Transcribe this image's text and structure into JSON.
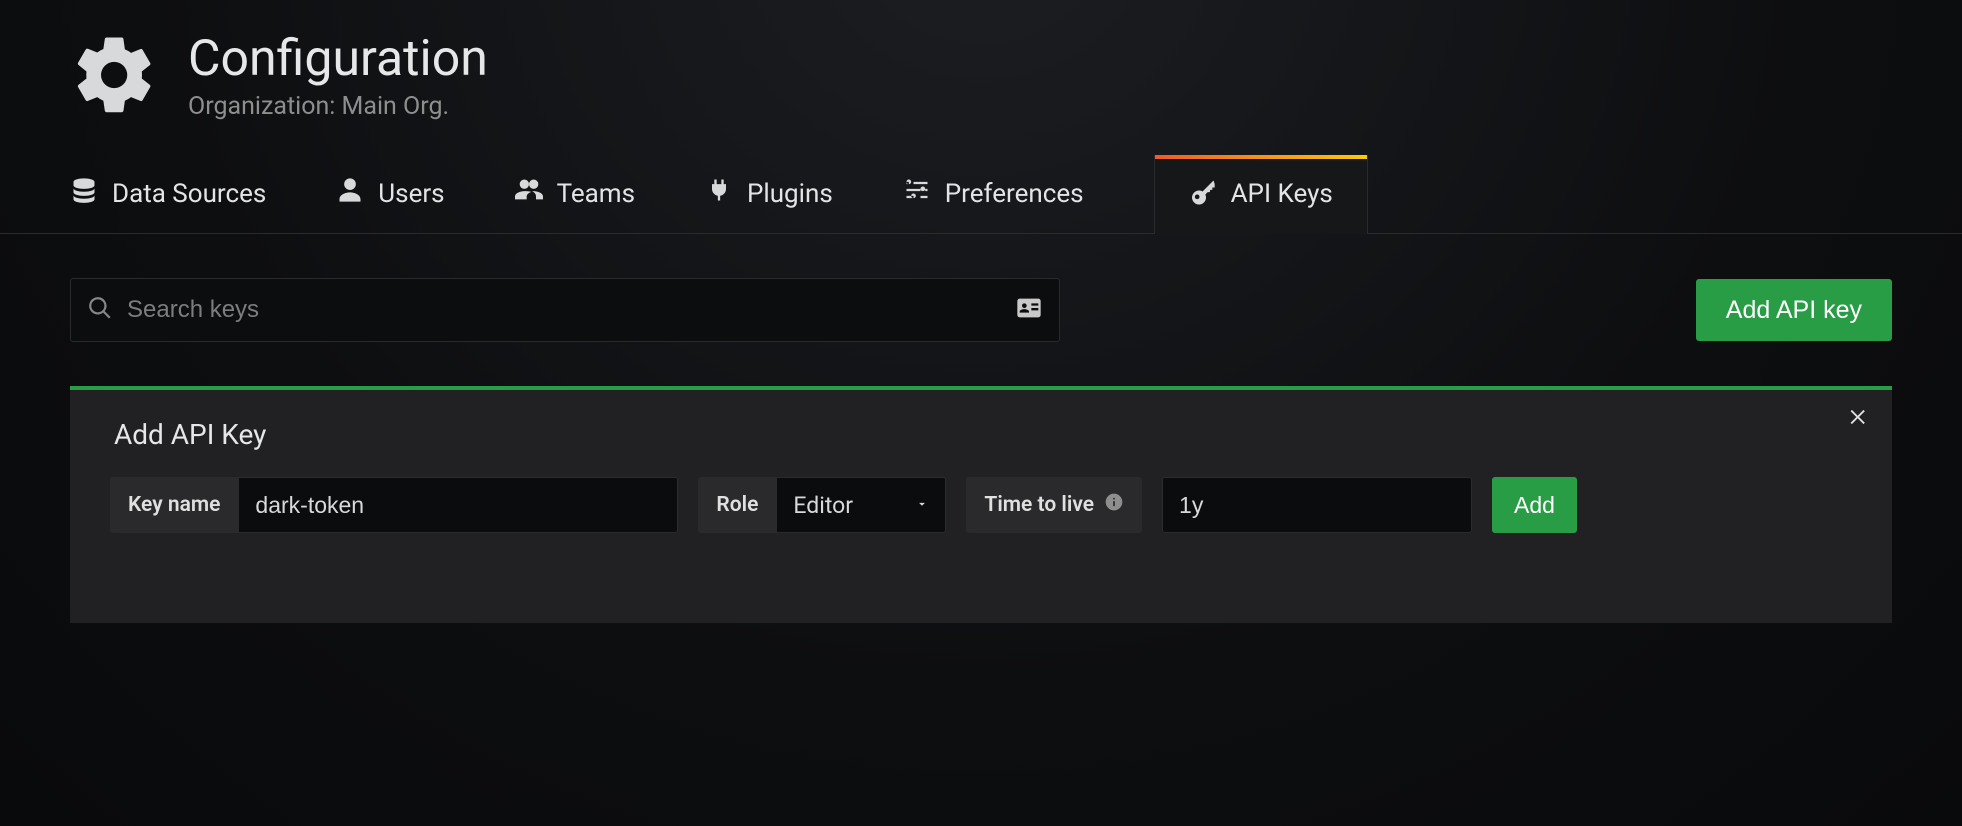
{
  "header": {
    "title": "Configuration",
    "subtitle": "Organization: Main Org."
  },
  "tabs": [
    {
      "id": "data-sources",
      "label": "Data Sources",
      "icon": "database",
      "active": false
    },
    {
      "id": "users",
      "label": "Users",
      "icon": "user",
      "active": false
    },
    {
      "id": "teams",
      "label": "Teams",
      "icon": "users",
      "active": false
    },
    {
      "id": "plugins",
      "label": "Plugins",
      "icon": "plug",
      "active": false
    },
    {
      "id": "preferences",
      "label": "Preferences",
      "icon": "sliders",
      "active": false
    },
    {
      "id": "api-keys",
      "label": "API Keys",
      "icon": "key",
      "active": true
    }
  ],
  "toolbar": {
    "search_placeholder": "Search keys",
    "add_api_key_label": "Add API key"
  },
  "panel": {
    "title": "Add API Key",
    "key_name_label": "Key name",
    "key_name_value": "dark-token",
    "role_label": "Role",
    "role_value": "Editor",
    "ttl_label": "Time to live",
    "ttl_value": "1y",
    "add_button_label": "Add"
  },
  "colors": {
    "accent_green": "#299c46",
    "tab_gradient_start": "#f05a28",
    "tab_gradient_end": "#fbca0a"
  }
}
